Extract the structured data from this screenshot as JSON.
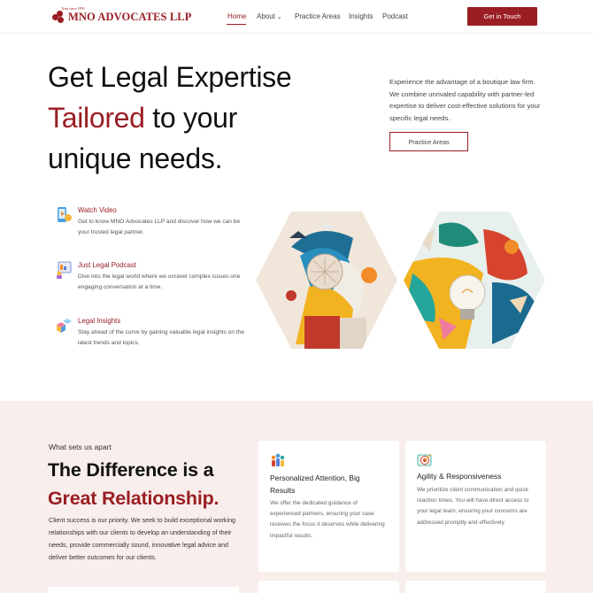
{
  "header": {
    "logo_small": "Trust since 1999",
    "logo_text": "MNO ADVOCATES LLP",
    "nav": [
      {
        "label": "Home",
        "active": true
      },
      {
        "label": "About",
        "has_dropdown": true
      },
      {
        "label": "Practice Areas"
      },
      {
        "label": "Insights"
      },
      {
        "label": "Podcast"
      }
    ],
    "cta_label": "Get in Touch"
  },
  "hero": {
    "title_line1": "Get Legal Expertise",
    "title_accent": "Tailored",
    "title_line2_rest": " to your",
    "title_line3": "unique needs.",
    "description": "Experience the advantage of a boutique law firm. We combine unrivaled capability with partner-led expertise to deliver cost-effective solutions for your specific legal needs.",
    "button_label": "Practice Areas"
  },
  "features": [
    {
      "icon": "video-phone-icon",
      "title": "Watch Video",
      "description": "Get to know MNO Advocates LLP and discover how we can be your trusted legal partner."
    },
    {
      "icon": "podcast-icon",
      "title": "Just Legal Podcast",
      "description": "Dive into the legal world where we unravel complex issues one engaging conversation at a time."
    },
    {
      "icon": "insights-cubes-icon",
      "title": "Legal Insights",
      "description": "Stay ahead of the curve by gaining valuable legal insights on the latest trends and topics."
    }
  ],
  "difference": {
    "eyebrow": "What sets us apart",
    "title_line1": "The Difference is a",
    "title_accent": "Great Relationship.",
    "description": "Client success is our priority. We seek to build exceptional working relationships with our clients to develop an understanding of their needs, provide commercially sound, innovative legal advice and deliver better outcomes for our clients."
  },
  "cards": [
    {
      "icon": "team-icon",
      "title": "Personalized Attention, Big Results",
      "description": "We offer the dedicated guidance of experienced partners, ensuring your case receives the focus it deserves while delivering impactful results."
    },
    {
      "icon": "target-icon",
      "title": "Agility & Responsiveness",
      "description": "We prioritize client communication and quick reaction times. You will have direct access to your legal team, ensuring your concerns are addressed promptly and effectively."
    }
  ],
  "colors": {
    "brand": "#9a1e24",
    "section_bg": "#f8eeec"
  }
}
